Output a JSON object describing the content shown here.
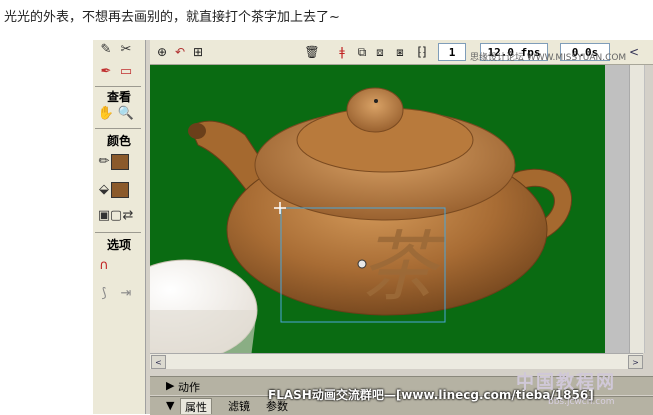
{
  "caption": "光光的外表，不想再去画别的，就直接打个茶字加上去了~",
  "tools": {
    "view_label": "查看",
    "color_label": "颜色",
    "options_label": "选项",
    "stroke_color": "#8b5a2b",
    "fill_color": "#8b5a2b"
  },
  "toolbar": {
    "frame_number": "1",
    "fps": "12.0 fps",
    "time": "0.0s"
  },
  "watermark_small": "思缘设计论坛 WWW.MISSYUAN.COM",
  "stage": {
    "background": "#0a6b12",
    "glyph": "茶"
  },
  "panels": {
    "actions_label": "动作",
    "tabs": [
      "属性",
      "滤镜",
      "参数"
    ]
  },
  "banner": "FLASH动画交流群吧—[www.linecg.com/tieba/1856]",
  "logo": "中国教程网",
  "logo_sub": "bbs.jcwcn.com"
}
